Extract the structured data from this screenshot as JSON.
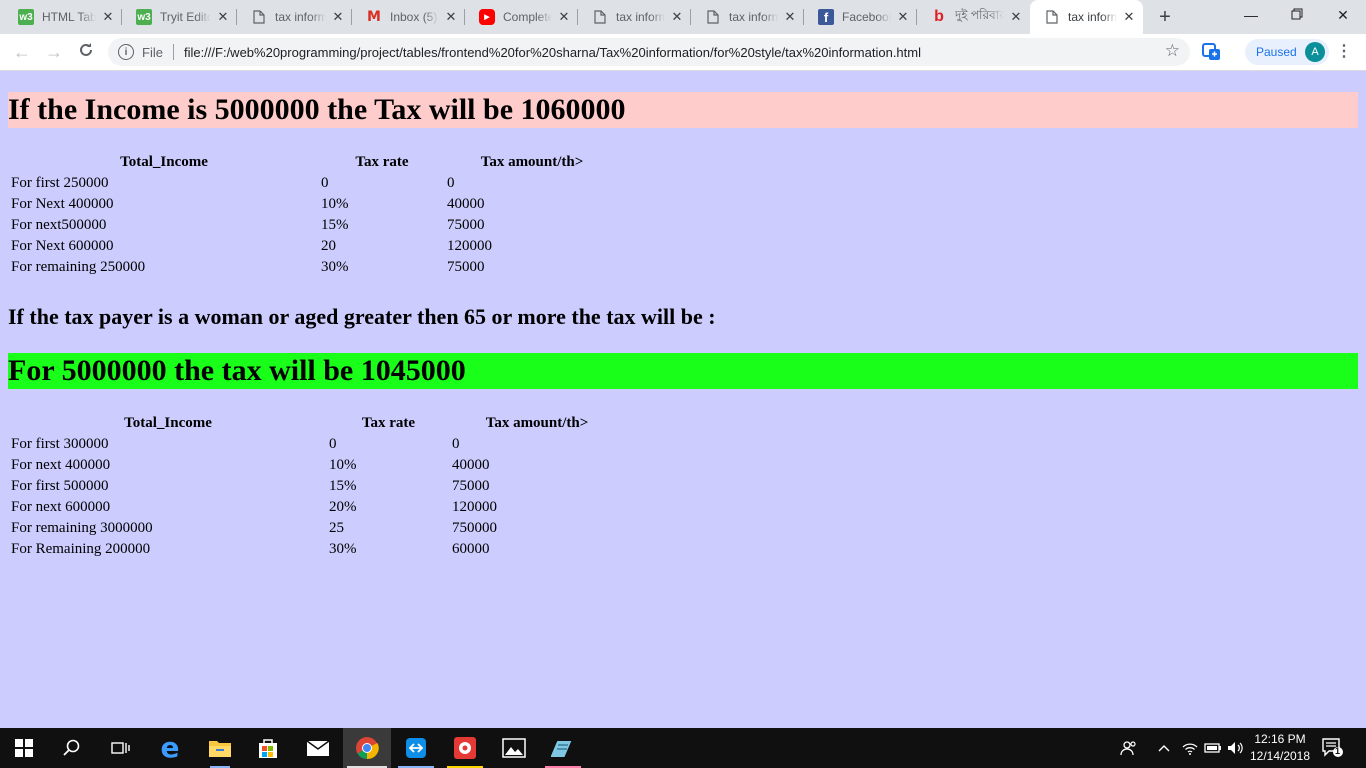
{
  "browser": {
    "tabs": [
      {
        "title": "HTML Tables",
        "icon": "w3schools-icon",
        "active": false
      },
      {
        "title": "Tryit Editor",
        "icon": "w3schools-icon",
        "active": false
      },
      {
        "title": "tax information",
        "icon": "document-icon",
        "active": false
      },
      {
        "title": "Inbox (5)",
        "icon": "gmail-icon",
        "active": false
      },
      {
        "title": "Complete",
        "icon": "youtube-icon",
        "active": false
      },
      {
        "title": "tax information",
        "icon": "document-icon",
        "active": false
      },
      {
        "title": "tax information",
        "icon": "document-icon",
        "active": false
      },
      {
        "title": "Facebook",
        "icon": "facebook-icon",
        "active": false
      },
      {
        "title": "দুই পরিবার",
        "icon": "b-icon",
        "active": false
      },
      {
        "title": "tax information",
        "icon": "document-icon",
        "active": true
      }
    ],
    "scheme_label": "File",
    "url": "file:///F:/web%20programming/project/tables/frontend%20for%20sharna/Tax%20information/for%20style/tax%20information.html",
    "profile_status": "Paused",
    "profile_initial": "A"
  },
  "page": {
    "heading1": "If the Income is 5000000 the Tax will be 1060000",
    "table1": {
      "headers": [
        "Total_Income",
        "Tax rate",
        "Tax amount/th>"
      ],
      "rows": [
        [
          "For first 250000",
          "0",
          "0"
        ],
        [
          "For Next 400000",
          "10%",
          "40000"
        ],
        [
          "For next500000",
          "15%",
          "75000"
        ],
        [
          "For Next 600000",
          "20",
          "120000"
        ],
        [
          "For remaining 250000",
          "30%",
          "75000"
        ]
      ]
    },
    "subheading": "If the tax payer is a woman or aged greater then 65 or more the tax will be :",
    "heading2": "For 5000000 the tax will be 1045000",
    "table2": {
      "headers": [
        "Total_Income",
        "Tax rate",
        "Tax amount/th>"
      ],
      "rows": [
        [
          "For first 300000",
          "0",
          "0"
        ],
        [
          "For next 400000",
          "10%",
          "40000"
        ],
        [
          "For first 500000",
          "15%",
          "75000"
        ],
        [
          "For next 600000",
          "20%",
          "120000"
        ],
        [
          "For remaining 3000000",
          "25",
          "750000"
        ],
        [
          "For Remaining 200000",
          "30%",
          "60000"
        ]
      ]
    },
    "colors": {
      "background": "#ccccfe",
      "heading1_bg": "#ffcccc",
      "heading2_bg": "#19ff19"
    }
  },
  "taskbar": {
    "time": "12:16 PM",
    "date": "12/14/2018",
    "notification_count": "1"
  }
}
